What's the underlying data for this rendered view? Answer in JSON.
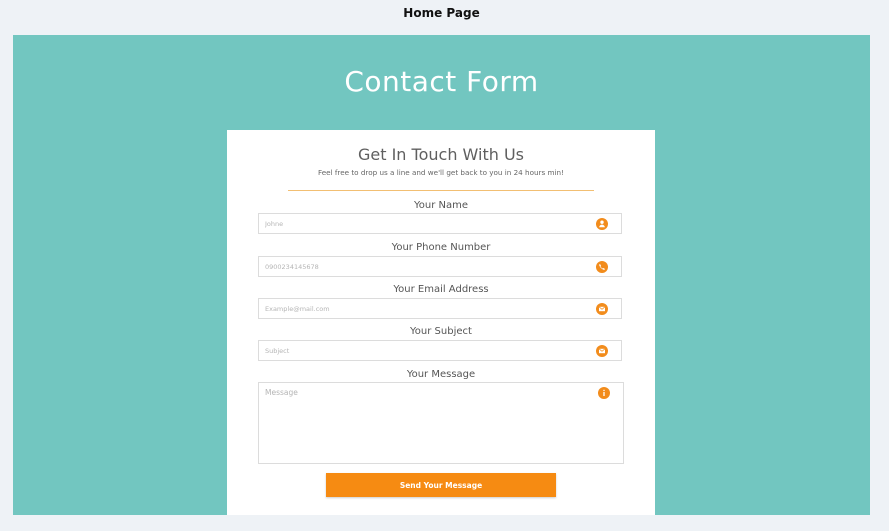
{
  "header": {
    "page_title": "Home Page"
  },
  "hero": {
    "title": "Contact Form"
  },
  "card": {
    "heading": "Get In Touch With Us",
    "subheading": "Feel free to drop us a line and we'll get back to you in 24 hours min!"
  },
  "fields": [
    {
      "label": "Your Name",
      "placeholder": "Johne",
      "icon": "person-icon"
    },
    {
      "label": "Your Phone Number",
      "placeholder": "0900234145678",
      "icon": "phone-icon"
    },
    {
      "label": "Your Email Address",
      "placeholder": "Example@mail.com",
      "icon": "envelope-icon"
    },
    {
      "label": "Your Subject",
      "placeholder": "Subject",
      "icon": "envelope-icon"
    }
  ],
  "message": {
    "label": "Your Message",
    "placeholder": "Message",
    "icon": "info-icon"
  },
  "button": {
    "label": "Send Your Message"
  },
  "colors": {
    "teal_background": "#72c6c0",
    "accent_orange": "#f68b12",
    "icon_orange": "#f28c1c"
  }
}
